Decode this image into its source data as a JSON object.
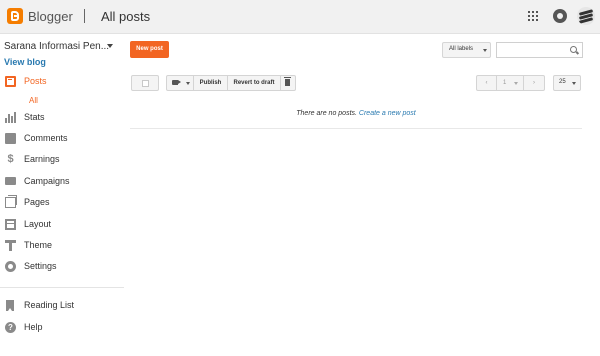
{
  "header": {
    "brand": "Blogger",
    "page_title": "All posts"
  },
  "sidebar": {
    "blog_name": "Sarana Informasi Pen...",
    "view_blog": "View blog",
    "items": [
      {
        "label": "Posts",
        "icon": "posts-icon",
        "active": true
      },
      {
        "label": "Stats",
        "icon": "stats-icon"
      },
      {
        "label": "Comments",
        "icon": "comments-icon"
      },
      {
        "label": "Earnings",
        "icon": "dollar-icon"
      },
      {
        "label": "Campaigns",
        "icon": "campaigns-icon"
      },
      {
        "label": "Pages",
        "icon": "pages-icon"
      },
      {
        "label": "Layout",
        "icon": "layout-icon"
      },
      {
        "label": "Theme",
        "icon": "theme-icon"
      },
      {
        "label": "Settings",
        "icon": "gear-icon"
      }
    ],
    "sub_item": "All",
    "bottom_items": [
      {
        "label": "Reading List",
        "icon": "bookmark-icon"
      },
      {
        "label": "Help",
        "icon": "help-icon"
      }
    ]
  },
  "toolbar": {
    "new_post": "New post",
    "labels_filter": "All labels",
    "search_placeholder": "",
    "publish": "Publish",
    "revert": "Revert to draft",
    "page": "1",
    "per_page": "25"
  },
  "main": {
    "empty_text": "There are no posts.",
    "create_link": "Create a new post"
  },
  "colors": {
    "accent": "#f26522",
    "link": "#2a7ab0"
  }
}
